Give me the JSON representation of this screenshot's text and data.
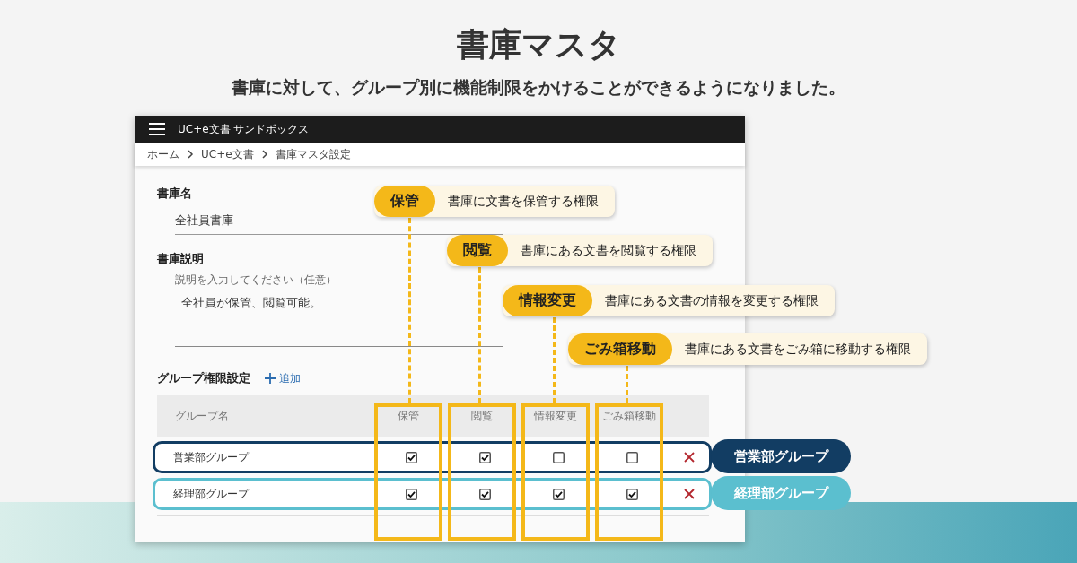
{
  "headline": {
    "title": "書庫マスタ",
    "subtitle": "書庫に対して、グループ別に機能制限をかけることができるようになりました。"
  },
  "app": {
    "title": "UC+e文書 サンドボックス",
    "breadcrumb": [
      "ホーム",
      "UC+e文書",
      "書庫マスタ設定"
    ]
  },
  "form": {
    "name_label": "書庫名",
    "name_value": "全社員書庫",
    "description_label": "書庫説明",
    "description_hint": "説明を入力してください（任意）",
    "description_value": "全社員が保管、閲覧可能。"
  },
  "groups": {
    "title": "グループ権限設定",
    "add_button": "追加",
    "columns": [
      "グループ名",
      "保管",
      "閲覧",
      "情報変更",
      "ごみ箱移動"
    ],
    "rows": [
      {
        "name": "営業部グループ",
        "color": "#123d63",
        "callout": "営業部グループ",
        "permissions": [
          {
            "checked": true
          },
          {
            "checked": true
          },
          {
            "checked": false
          },
          {
            "checked": false
          }
        ]
      },
      {
        "name": "経理部グループ",
        "color": "#5bbfcf",
        "callout": "経理部グループ",
        "permissions": [
          {
            "checked": true
          },
          {
            "checked": true
          },
          {
            "checked": true
          },
          {
            "checked": true
          }
        ]
      }
    ]
  },
  "callouts": [
    {
      "label": "保管",
      "description": "書庫に文書を保管する権限"
    },
    {
      "label": "閲覧",
      "description": "書庫にある文書を閲覧する権限"
    },
    {
      "label": "情報変更",
      "description": "書庫にある文書の情報を変更する権限"
    },
    {
      "label": "ごみ箱移動",
      "description": "書庫にある文書をごみ箱に移動する権限"
    }
  ]
}
